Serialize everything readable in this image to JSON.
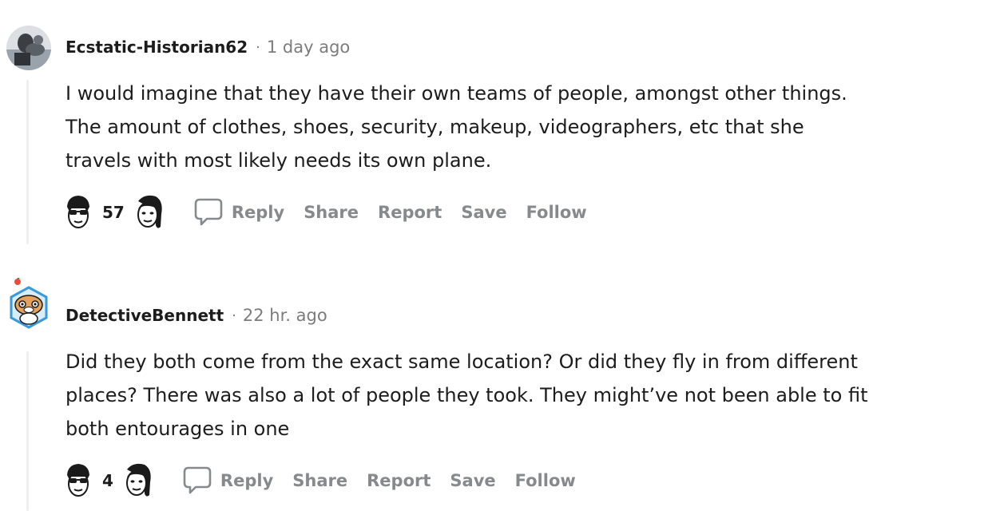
{
  "comments": [
    {
      "username": "Ecstatic-Historian62",
      "separator": "·",
      "time": "1 day ago",
      "body": [
        "I would imagine that they have their own teams of people, amongst other things.",
        "The amount of clothes, shoes, security, makeup, videographers, etc that she",
        "travels with most likely needs its own plane."
      ],
      "score": "57",
      "avatar_icon": "user-photo-avatar",
      "upvote_icon": "face-glasses-upvote-icon",
      "downvote_icon": "face-downvote-icon"
    },
    {
      "username": "DetectiveBennett",
      "separator": "·",
      "time": "22 hr. ago",
      "body": [
        "Did they both come from the exact same location? Or did they fly in from different",
        "places? There was also a lot of people they took. They might’ve not been able to fit",
        "both entourages in one"
      ],
      "score": "4",
      "avatar_icon": "hamster-snoo-avatar",
      "upvote_icon": "face-glasses-upvote-icon",
      "downvote_icon": "face-downvote-icon"
    }
  ],
  "actions": {
    "reply": "Reply",
    "share": "Share",
    "report": "Report",
    "save": "Save",
    "follow": "Follow"
  },
  "colors": {
    "meta_gray": "#7c7c7c",
    "action_gray": "#878a8c",
    "thread_line": "#edeff1",
    "text": "#1c1c1c"
  }
}
